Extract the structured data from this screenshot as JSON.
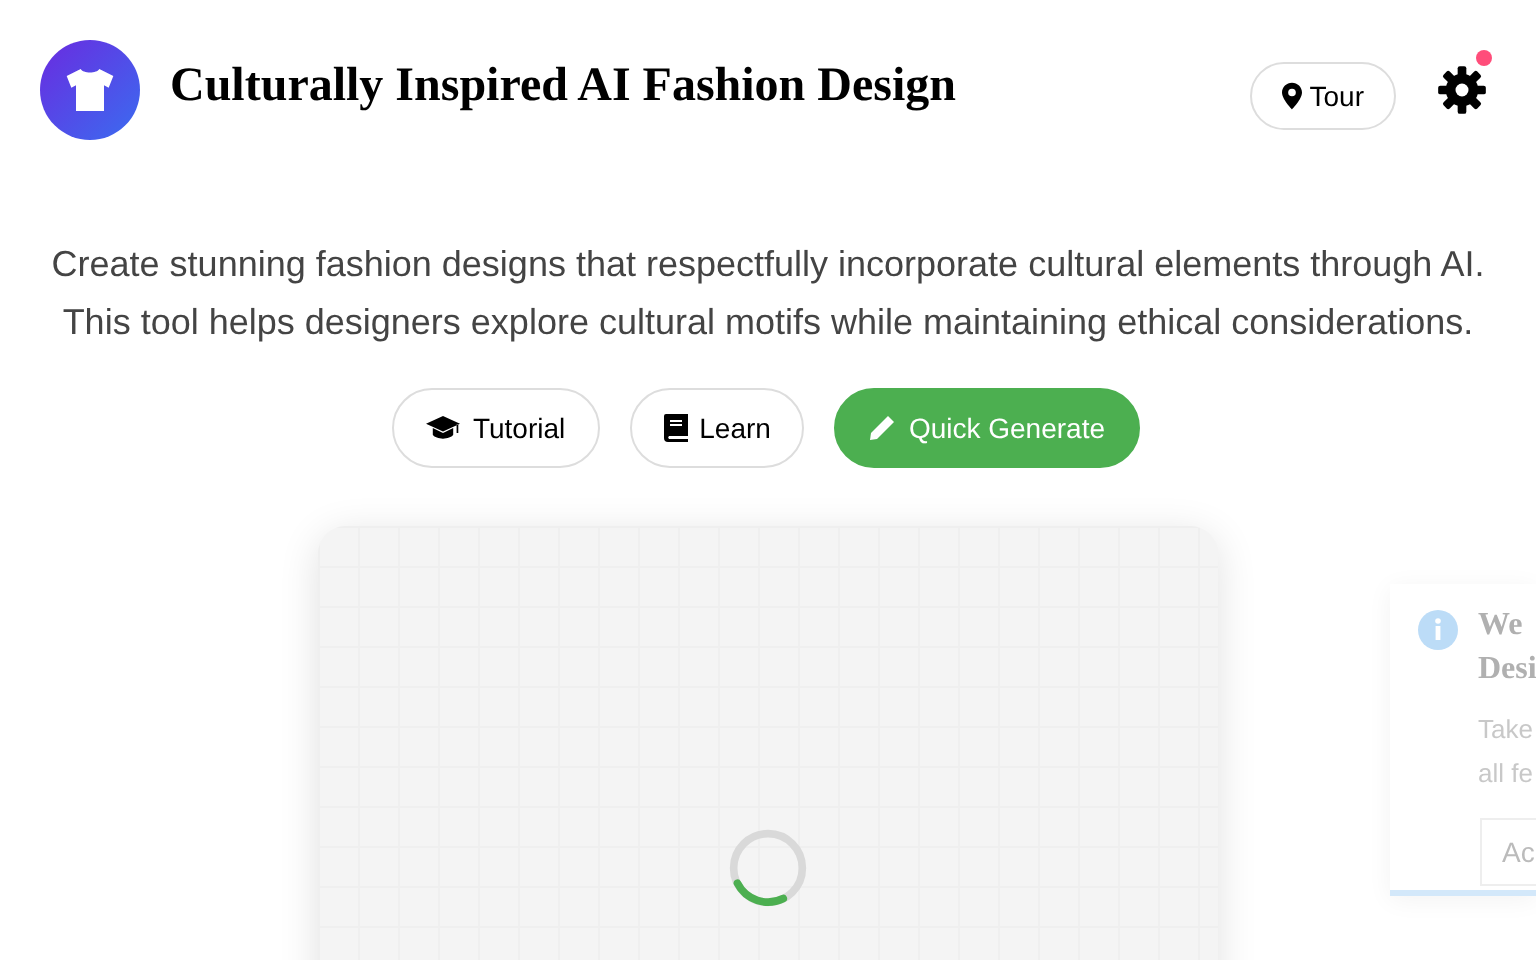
{
  "header": {
    "title": "Culturally Inspired AI Fashion Design",
    "tour_button": "Tour",
    "settings": {
      "notification": true
    }
  },
  "intro": "Create stunning fashion designs that respectfully incorporate cultural elements through AI. This tool helps designers explore cultural motifs while maintaining ethical considerations.",
  "actions": [
    {
      "kind": "tutorial",
      "label": "Tutorial",
      "primary": false
    },
    {
      "kind": "learn",
      "label": "Learn",
      "primary": false
    },
    {
      "kind": "generate",
      "label": "Quick Generate",
      "primary": true
    }
  ],
  "canvas": {
    "loading": true
  },
  "toast": {
    "title_lines": [
      "We",
      "Desi"
    ],
    "text_lines": [
      "Take",
      "all fe"
    ],
    "button": "Ac"
  }
}
